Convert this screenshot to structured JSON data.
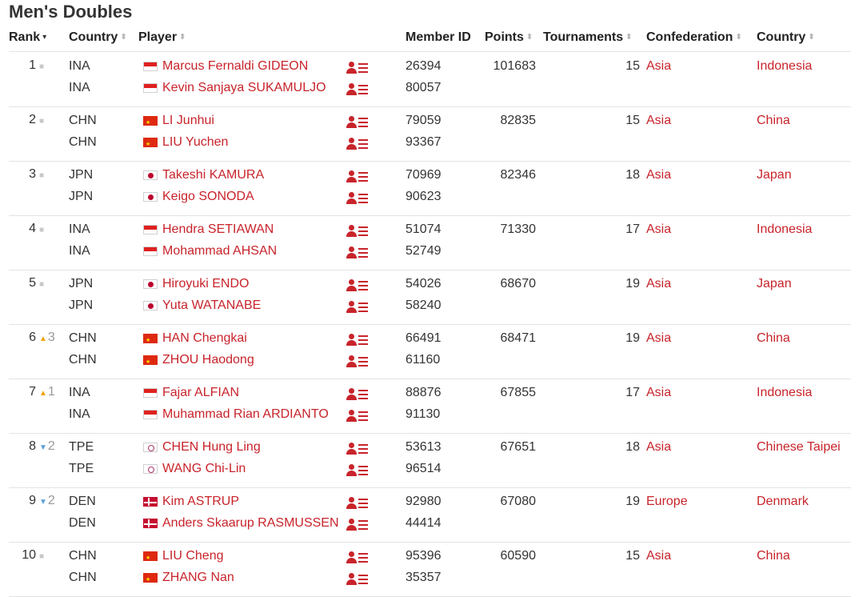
{
  "title": "Men's Doubles",
  "columns": {
    "rank": "Rank",
    "country": "Country",
    "player": "Player",
    "member_id": "Member ID",
    "points": "Points",
    "tournaments": "Tournaments",
    "confederation": "Confederation",
    "country2": "Country"
  },
  "rows": [
    {
      "rank": "1",
      "move": "",
      "dir": "same",
      "p1": {
        "country": "INA",
        "name": "Marcus Fernaldi GIDEON",
        "id": "26394",
        "flag": "ina"
      },
      "p2": {
        "country": "INA",
        "name": "Kevin Sanjaya SUKAMULJO",
        "id": "80057",
        "flag": "ina"
      },
      "points": "101683",
      "tournaments": "15",
      "confederation": "Asia",
      "team_country": "Indonesia"
    },
    {
      "rank": "2",
      "move": "",
      "dir": "same",
      "p1": {
        "country": "CHN",
        "name": "LI Junhui",
        "id": "79059",
        "flag": "chn"
      },
      "p2": {
        "country": "CHN",
        "name": "LIU Yuchen",
        "id": "93367",
        "flag": "chn"
      },
      "points": "82835",
      "tournaments": "15",
      "confederation": "Asia",
      "team_country": "China"
    },
    {
      "rank": "3",
      "move": "",
      "dir": "same",
      "p1": {
        "country": "JPN",
        "name": "Takeshi KAMURA",
        "id": "70969",
        "flag": "jpn"
      },
      "p2": {
        "country": "JPN",
        "name": "Keigo SONODA",
        "id": "90623",
        "flag": "jpn"
      },
      "points": "82346",
      "tournaments": "18",
      "confederation": "Asia",
      "team_country": "Japan"
    },
    {
      "rank": "4",
      "move": "",
      "dir": "same",
      "p1": {
        "country": "INA",
        "name": "Hendra SETIAWAN",
        "id": "51074",
        "flag": "ina"
      },
      "p2": {
        "country": "INA",
        "name": "Mohammad AHSAN",
        "id": "52749",
        "flag": "ina"
      },
      "points": "71330",
      "tournaments": "17",
      "confederation": "Asia",
      "team_country": "Indonesia"
    },
    {
      "rank": "5",
      "move": "",
      "dir": "same",
      "p1": {
        "country": "JPN",
        "name": "Hiroyuki ENDO",
        "id": "54026",
        "flag": "jpn"
      },
      "p2": {
        "country": "JPN",
        "name": "Yuta WATANABE",
        "id": "58240",
        "flag": "jpn"
      },
      "points": "68670",
      "tournaments": "19",
      "confederation": "Asia",
      "team_country": "Japan"
    },
    {
      "rank": "6",
      "move": "3",
      "dir": "up",
      "p1": {
        "country": "CHN",
        "name": "HAN Chengkai",
        "id": "66491",
        "flag": "chn"
      },
      "p2": {
        "country": "CHN",
        "name": "ZHOU Haodong",
        "id": "61160",
        "flag": "chn"
      },
      "points": "68471",
      "tournaments": "19",
      "confederation": "Asia",
      "team_country": "China"
    },
    {
      "rank": "7",
      "move": "1",
      "dir": "up",
      "p1": {
        "country": "INA",
        "name": "Fajar ALFIAN",
        "id": "88876",
        "flag": "ina"
      },
      "p2": {
        "country": "INA",
        "name": "Muhammad Rian ARDIANTO",
        "id": "91130",
        "flag": "ina"
      },
      "points": "67855",
      "tournaments": "17",
      "confederation": "Asia",
      "team_country": "Indonesia"
    },
    {
      "rank": "8",
      "move": "2",
      "dir": "down",
      "p1": {
        "country": "TPE",
        "name": "CHEN Hung Ling",
        "id": "53613",
        "flag": "tpe"
      },
      "p2": {
        "country": "TPE",
        "name": "WANG Chi-Lin",
        "id": "96514",
        "flag": "tpe"
      },
      "points": "67651",
      "tournaments": "18",
      "confederation": "Asia",
      "team_country": "Chinese Taipei"
    },
    {
      "rank": "9",
      "move": "2",
      "dir": "down",
      "p1": {
        "country": "DEN",
        "name": "Kim ASTRUP",
        "id": "92980",
        "flag": "den"
      },
      "p2": {
        "country": "DEN",
        "name": "Anders Skaarup RASMUSSEN",
        "id": "44414",
        "flag": "den"
      },
      "points": "67080",
      "tournaments": "19",
      "confederation": "Europe",
      "team_country": "Denmark"
    },
    {
      "rank": "10",
      "move": "",
      "dir": "same",
      "p1": {
        "country": "CHN",
        "name": "LIU Cheng",
        "id": "95396",
        "flag": "chn"
      },
      "p2": {
        "country": "CHN",
        "name": "ZHANG Nan",
        "id": "35357",
        "flag": "chn"
      },
      "points": "60590",
      "tournaments": "15",
      "confederation": "Asia",
      "team_country": "China"
    }
  ],
  "colors": {
    "link": "#c8242b",
    "up": "#f0a30a",
    "down": "#5aa0d8",
    "same": "#c8c8c8"
  },
  "icons": {
    "sort": "sort-caret-icon",
    "player_profile": "player-profile-icon",
    "flag": "flag-icon"
  }
}
